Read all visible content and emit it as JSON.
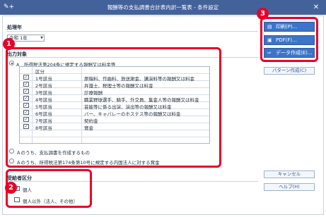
{
  "window": {
    "title": "報酬等の支払調書合計表内訳一覧表 - 条件設定",
    "app_icon": "✎+",
    "close": "✕"
  },
  "period": {
    "label": "処理年",
    "value": "令和 1年"
  },
  "output_target": {
    "label": "出力対象",
    "option_a": "A　所得税法第204条に規定する報酬又は料金等",
    "table": {
      "header": "区分",
      "rows": [
        {
          "checked": true,
          "code": "1号該当",
          "desc": "原稿料、作曲料、放送謝金、講演料等の報酬又は料金"
        },
        {
          "checked": true,
          "code": "2号該当",
          "desc": "弁護士、税理士等の報酬又は料金"
        },
        {
          "checked": true,
          "code": "3号該当",
          "desc": "診療報酬"
        },
        {
          "checked": true,
          "code": "4号該当",
          "desc": "職業野球選手、騎手、外交員、集金人等の報酬又は料金"
        },
        {
          "checked": true,
          "code": "5号該当",
          "desc": "芸能等に係る出演、演出等の報酬又は料金"
        },
        {
          "checked": true,
          "code": "6号該当",
          "desc": "バー、キャバレーのホステス等の報酬又は料金"
        },
        {
          "checked": true,
          "code": "7号該当",
          "desc": "契約金"
        },
        {
          "checked": true,
          "code": "8号該当",
          "desc": "賞金"
        }
      ],
      "check_mark": "✓"
    },
    "option_b": "Ａのうち、支払調書を作成するもの",
    "option_c": "Ａのうち、所得税法第174条第10号に規定する内国法人に対する賞金"
  },
  "recipient": {
    "label": "受給者区分",
    "individual": "個人",
    "other": "個人以外（法人、その他）"
  },
  "buttons": {
    "print": "印刷(P)...",
    "pdf": "PDF(F)...",
    "data": "データ作成(E)...",
    "pattern": "パターン作成(C)",
    "cancel": "キャンセル",
    "help": "ヘルプ(H)"
  },
  "annotations": {
    "badge1": "1",
    "badge2": "2",
    "badge3": "3"
  },
  "colors": {
    "titlebar": "#44629a",
    "accent": "#3d74c9",
    "highlight": "#e8002a"
  }
}
